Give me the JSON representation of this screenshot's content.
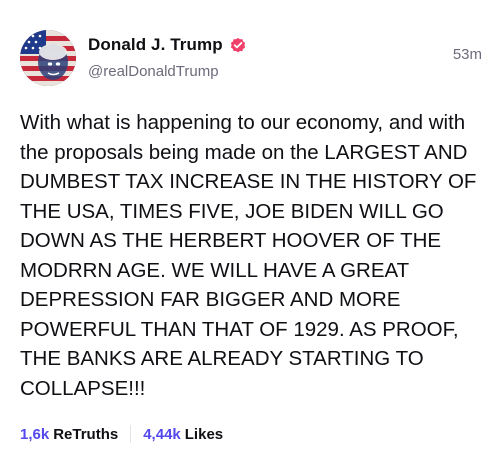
{
  "author": {
    "display_name": "Donald J. Trump",
    "handle": "@realDonaldTrump",
    "verified": true,
    "avatar_icon": "avatar-image"
  },
  "timestamp": "53m",
  "post": {
    "text": "With what is happening to our economy, and with the proposals being made on the LARGEST AND DUMBEST TAX INCREASE IN THE HISTORY OF THE USA, TIMES FIVE, JOE BIDEN WILL GO DOWN AS THE HERBERT HOOVER OF THE MODRRN AGE. WE WILL HAVE A GREAT DEPRESSION FAR BIGGER AND MORE POWERFUL THAN THAT OF 1929. AS PROOF, THE BANKS ARE ALREADY STARTING TO COLLAPSE!!!"
  },
  "stats": {
    "retruths_count": "1,6k",
    "retruths_label": "ReTruths",
    "likes_count": "4,44k",
    "likes_label": "Likes"
  },
  "colors": {
    "accent": "#5448ee",
    "verified_badge": "#f0416b",
    "secondary_text": "#6b6b7b"
  }
}
